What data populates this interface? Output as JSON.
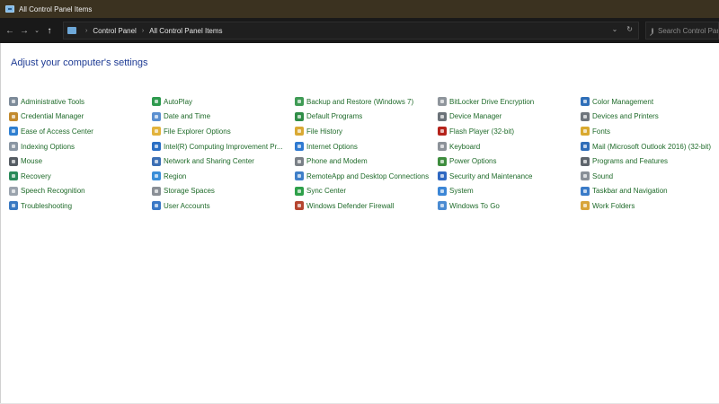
{
  "window": {
    "title": "All Control Panel Items",
    "title_icon": "control-panel-icon"
  },
  "nav": {
    "back": "←",
    "forward": "→",
    "recent": "⌄",
    "up": "↑",
    "breadcrumb": [
      "Control Panel",
      "All Control Panel Items"
    ],
    "separator": "›",
    "dropdown": "⌄",
    "refresh": "↻",
    "search_placeholder": "Search Control Panel"
  },
  "main": {
    "heading": "Adjust your computer's settings",
    "items": [
      {
        "label": "Administrative Tools",
        "icon": "admin-tools-icon",
        "color": "#7d8b99"
      },
      {
        "label": "Credential Manager",
        "icon": "credential-manager-icon",
        "color": "#c28a2e"
      },
      {
        "label": "Ease of Access Center",
        "icon": "ease-of-access-icon",
        "color": "#2f7fd1"
      },
      {
        "label": "Indexing Options",
        "icon": "indexing-options-icon",
        "color": "#8a96a3"
      },
      {
        "label": "Mouse",
        "icon": "mouse-icon",
        "color": "#555c63"
      },
      {
        "label": "Recovery",
        "icon": "recovery-icon",
        "color": "#2a8a5a"
      },
      {
        "label": "Speech Recognition",
        "icon": "speech-recognition-icon",
        "color": "#9aa3ad"
      },
      {
        "label": "Troubleshooting",
        "icon": "troubleshooting-icon",
        "color": "#3a79c2"
      },
      {
        "label": "AutoPlay",
        "icon": "autoplay-icon",
        "color": "#2e9a4e"
      },
      {
        "label": "Date and Time",
        "icon": "date-time-icon",
        "color": "#5a8fd0"
      },
      {
        "label": "File Explorer Options",
        "icon": "file-explorer-options-icon",
        "color": "#e2b33c"
      },
      {
        "label": "Intel(R) Computing Improvement Pr...",
        "icon": "intel-icon",
        "color": "#2a6fc4"
      },
      {
        "label": "Network and Sharing Center",
        "icon": "network-icon",
        "color": "#3c6fb4"
      },
      {
        "label": "Region",
        "icon": "region-icon",
        "color": "#3b8ed8"
      },
      {
        "label": "Storage Spaces",
        "icon": "storage-spaces-icon",
        "color": "#8a8f96"
      },
      {
        "label": "User Accounts",
        "icon": "user-accounts-icon",
        "color": "#3a78c6"
      },
      {
        "label": "Backup and Restore (Windows 7)",
        "icon": "backup-restore-icon",
        "color": "#3f9b55"
      },
      {
        "label": "Default Programs",
        "icon": "default-programs-icon",
        "color": "#2f8d47"
      },
      {
        "label": "File History",
        "icon": "file-history-icon",
        "color": "#d9a934"
      },
      {
        "label": "Internet Options",
        "icon": "internet-options-icon",
        "color": "#2f7ad1"
      },
      {
        "label": "Phone and Modem",
        "icon": "phone-modem-icon",
        "color": "#7a8087"
      },
      {
        "label": "RemoteApp and Desktop Connections",
        "icon": "remoteapp-icon",
        "color": "#3f7fc8"
      },
      {
        "label": "Sync Center",
        "icon": "sync-center-icon",
        "color": "#2ea04a"
      },
      {
        "label": "Windows Defender Firewall",
        "icon": "firewall-icon",
        "color": "#b5452f"
      },
      {
        "label": "BitLocker Drive Encryption",
        "icon": "bitlocker-icon",
        "color": "#8f959c"
      },
      {
        "label": "Device Manager",
        "icon": "device-manager-icon",
        "color": "#6b7279"
      },
      {
        "label": "Flash Player (32-bit)",
        "icon": "flash-player-icon",
        "color": "#b5231b"
      },
      {
        "label": "Keyboard",
        "icon": "keyboard-icon",
        "color": "#8c9299"
      },
      {
        "label": "Power Options",
        "icon": "power-options-icon",
        "color": "#3e8d3e"
      },
      {
        "label": "Security and Maintenance",
        "icon": "security-maintenance-icon",
        "color": "#2f68c2"
      },
      {
        "label": "System",
        "icon": "system-icon",
        "color": "#3b86d6"
      },
      {
        "label": "Windows To Go",
        "icon": "windows-to-go-icon",
        "color": "#4a8bd2"
      },
      {
        "label": "Color Management",
        "icon": "color-management-icon",
        "color": "#2f6fb8"
      },
      {
        "label": "Devices and Printers",
        "icon": "devices-printers-icon",
        "color": "#6f757c"
      },
      {
        "label": "Fonts",
        "icon": "fonts-icon",
        "color": "#d9a92f"
      },
      {
        "label": "Mail (Microsoft Outlook 2016) (32-bit)",
        "icon": "mail-icon",
        "color": "#2f6db8"
      },
      {
        "label": "Programs and Features",
        "icon": "programs-features-icon",
        "color": "#5e656c"
      },
      {
        "label": "Sound",
        "icon": "sound-icon",
        "color": "#8a9097"
      },
      {
        "label": "Taskbar and Navigation",
        "icon": "taskbar-navigation-icon",
        "color": "#3a7bc8"
      },
      {
        "label": "Work Folders",
        "icon": "work-folders-icon",
        "color": "#d8a53a"
      }
    ]
  }
}
